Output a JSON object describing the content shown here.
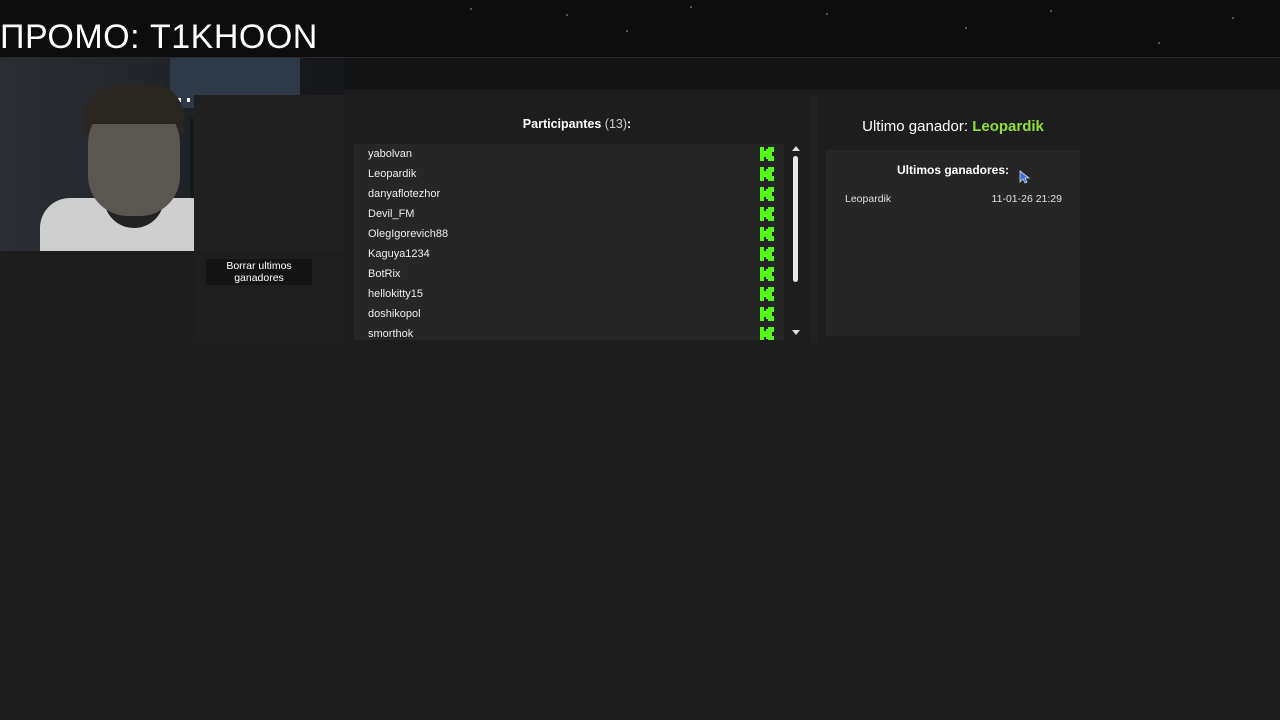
{
  "header": {
    "promo_text": "ПРОМО: T1KHOON"
  },
  "actions": {
    "clear_winners_label": "Borrar ultimos ganadores"
  },
  "participants": {
    "title": "Participantes",
    "count": "(13)",
    "suffix": ":",
    "items": [
      {
        "name": "yabolvan",
        "platform_icon": "kick-icon"
      },
      {
        "name": "Leopardik",
        "platform_icon": "kick-icon"
      },
      {
        "name": "danyaflotezhor",
        "platform_icon": "kick-icon"
      },
      {
        "name": "Devil_FM",
        "platform_icon": "kick-icon"
      },
      {
        "name": "OlegIgorevich88",
        "platform_icon": "kick-icon"
      },
      {
        "name": "Kaguya1234",
        "platform_icon": "kick-icon"
      },
      {
        "name": "BotRix",
        "platform_icon": "kick-icon"
      },
      {
        "name": "hellokitty15",
        "platform_icon": "kick-icon"
      },
      {
        "name": "doshikopol",
        "platform_icon": "kick-icon"
      },
      {
        "name": "smorthok",
        "platform_icon": "kick-icon"
      }
    ]
  },
  "winners": {
    "last_winner_label": "Ultimo ganador:",
    "last_winner_name": "Leopardik",
    "recent_title": "Ultimos ganadores:",
    "recent": [
      {
        "name": "Leopardik",
        "date": "11-01-26 21:29"
      }
    ]
  },
  "colors": {
    "accent_green": "#8fe03a",
    "kick_green": "#53fc18",
    "background": "#1c1c1c"
  }
}
